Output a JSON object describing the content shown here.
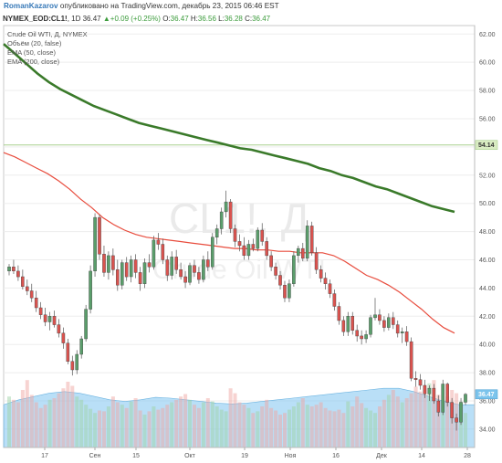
{
  "header": {
    "author": "RomanKazarov",
    "published": "опубликовано на TradingView.com, декабрь 23, 2015 06:46 EST"
  },
  "symbol_bar": {
    "symbol": "NYMEX_EOD:CL1!",
    "interval": "1D",
    "last": "36.47",
    "change": "+0.09 (+0.25%)",
    "open_label": "O:",
    "open": "36.47",
    "high_label": "H:",
    "high": "36.56",
    "low_label": "L:",
    "low": "36.28",
    "close_label": "C:",
    "close": "36.47"
  },
  "legend": {
    "title": "Crude Oil WTI, Д, NYMEX",
    "volume": "Объём (20, false)",
    "ema50": "EMA (50, close)",
    "ema200": "EMA (200, close)"
  },
  "watermark": {
    "symbol": "CL1!, Д",
    "name": "Crude Oil WTI"
  },
  "colors": {
    "up": "#5a9e6b",
    "down": "#d9534f",
    "ema50": "#e84c3d",
    "ema200": "#3a7a2a",
    "volume_area": "#7fc4f0",
    "hline": "#a8d08d"
  },
  "tags": {
    "hline": "54.14",
    "last": "36.47"
  },
  "chart_data": {
    "type": "candlestick",
    "title": "Crude Oil WTI, Д, NYMEX",
    "ylim": [
      33,
      62.5
    ],
    "y_ticks": [
      "62.00",
      "60.00",
      "58.00",
      "56.00",
      "54.00",
      "52.00",
      "50.00",
      "48.00",
      "46.00",
      "44.00",
      "42.00",
      "40.00",
      "38.00",
      "36.00",
      "34.00"
    ],
    "x_ticks": [
      "17",
      "Сен",
      "15",
      "Окт",
      "19",
      "Ноя",
      "16",
      "Дек",
      "14",
      "28"
    ],
    "horizontal_line": 54.14,
    "candles": [
      [
        45.2,
        45.7,
        44.9,
        45.5
      ],
      [
        45.5,
        46.0,
        45.0,
        45.2
      ],
      [
        45.2,
        45.6,
        44.5,
        44.8
      ],
      [
        44.8,
        45.3,
        43.9,
        44.1
      ],
      [
        44.1,
        44.6,
        43.5,
        43.8
      ],
      [
        43.8,
        44.3,
        43.0,
        43.3
      ],
      [
        43.3,
        43.8,
        42.3,
        42.6
      ],
      [
        42.6,
        43.0,
        41.8,
        42.1
      ],
      [
        42.1,
        42.6,
        41.3,
        41.6
      ],
      [
        41.6,
        42.3,
        41.0,
        42.0
      ],
      [
        42.0,
        42.4,
        41.2,
        41.4
      ],
      [
        41.4,
        41.8,
        40.5,
        40.8
      ],
      [
        40.8,
        41.2,
        39.7,
        40.1
      ],
      [
        40.1,
        40.4,
        38.6,
        38.8
      ],
      [
        38.8,
        39.2,
        37.8,
        38.2
      ],
      [
        38.2,
        39.6,
        37.9,
        39.3
      ],
      [
        39.3,
        40.6,
        39.0,
        40.4
      ],
      [
        40.4,
        42.8,
        40.2,
        42.5
      ],
      [
        42.5,
        45.6,
        42.2,
        45.2
      ],
      [
        45.2,
        49.3,
        44.8,
        49.0
      ],
      [
        49.0,
        49.2,
        46.0,
        46.4
      ],
      [
        46.4,
        47.0,
        44.8,
        45.1
      ],
      [
        45.1,
        46.6,
        44.6,
        46.3
      ],
      [
        46.3,
        46.8,
        44.9,
        45.3
      ],
      [
        45.3,
        46.0,
        43.8,
        44.2
      ],
      [
        44.2,
        46.0,
        43.9,
        45.8
      ],
      [
        45.8,
        46.2,
        44.5,
        44.8
      ],
      [
        44.8,
        46.3,
        44.4,
        46.0
      ],
      [
        46.0,
        46.4,
        44.7,
        45.1
      ],
      [
        45.1,
        45.5,
        43.8,
        44.3
      ],
      [
        44.3,
        46.1,
        44.0,
        45.8
      ],
      [
        45.8,
        46.4,
        45.1,
        45.5
      ],
      [
        45.5,
        47.7,
        45.3,
        47.4
      ],
      [
        47.4,
        47.9,
        46.7,
        47.1
      ],
      [
        47.1,
        47.5,
        45.7,
        46.0
      ],
      [
        46.0,
        46.3,
        44.5,
        44.9
      ],
      [
        44.9,
        46.6,
        44.6,
        46.2
      ],
      [
        46.2,
        46.7,
        45.0,
        45.3
      ],
      [
        45.3,
        45.8,
        44.6,
        44.8
      ],
      [
        44.8,
        45.2,
        44.0,
        44.4
      ],
      [
        44.4,
        45.8,
        44.2,
        45.6
      ],
      [
        45.6,
        46.0,
        44.8,
        45.1
      ],
      [
        45.1,
        45.5,
        44.3,
        44.6
      ],
      [
        44.6,
        46.3,
        44.4,
        46.0
      ],
      [
        46.0,
        46.6,
        45.2,
        45.5
      ],
      [
        45.5,
        47.9,
        45.3,
        47.6
      ],
      [
        47.6,
        48.5,
        47.1,
        48.2
      ],
      [
        48.2,
        49.7,
        47.8,
        49.4
      ],
      [
        49.4,
        50.9,
        49.0,
        50.1
      ],
      [
        50.1,
        50.3,
        47.9,
        48.2
      ],
      [
        48.2,
        48.5,
        46.9,
        47.3
      ],
      [
        47.3,
        47.8,
        46.6,
        47.0
      ],
      [
        47.0,
        47.6,
        46.0,
        46.3
      ],
      [
        46.3,
        47.4,
        46.0,
        47.1
      ],
      [
        47.1,
        47.5,
        46.6,
        46.8
      ],
      [
        46.8,
        48.3,
        46.6,
        48.1
      ],
      [
        48.1,
        48.6,
        47.0,
        47.3
      ],
      [
        47.3,
        47.6,
        46.0,
        46.3
      ],
      [
        46.3,
        46.6,
        45.2,
        45.5
      ],
      [
        45.5,
        45.8,
        44.6,
        44.9
      ],
      [
        44.9,
        45.2,
        43.9,
        44.2
      ],
      [
        44.2,
        44.5,
        43.0,
        43.3
      ],
      [
        43.3,
        44.6,
        43.0,
        44.3
      ],
      [
        44.3,
        46.6,
        44.1,
        46.3
      ],
      [
        46.3,
        47.0,
        45.8,
        46.8
      ],
      [
        46.8,
        47.2,
        45.9,
        46.1
      ],
      [
        46.1,
        48.8,
        45.9,
        48.4
      ],
      [
        48.4,
        48.7,
        46.3,
        46.5
      ],
      [
        46.5,
        46.9,
        45.0,
        45.3
      ],
      [
        45.3,
        45.6,
        44.4,
        44.7
      ],
      [
        44.7,
        45.1,
        43.9,
        44.3
      ],
      [
        44.3,
        44.6,
        43.3,
        43.6
      ],
      [
        43.6,
        43.9,
        42.4,
        42.7
      ],
      [
        42.7,
        43.0,
        41.4,
        41.7
      ],
      [
        41.7,
        42.0,
        40.6,
        40.9
      ],
      [
        40.9,
        42.3,
        40.6,
        42.0
      ],
      [
        42.0,
        42.3,
        40.7,
        41.0
      ],
      [
        41.0,
        41.4,
        40.2,
        40.6
      ],
      [
        40.6,
        41.0,
        40.0,
        40.4
      ],
      [
        40.4,
        41.0,
        40.1,
        40.7
      ],
      [
        40.7,
        42.1,
        40.5,
        41.9
      ],
      [
        41.9,
        43.3,
        41.7,
        42.1
      ],
      [
        42.1,
        42.5,
        41.4,
        41.7
      ],
      [
        41.7,
        42.0,
        40.9,
        41.2
      ],
      [
        41.2,
        42.2,
        41.0,
        41.9
      ],
      [
        41.9,
        42.3,
        41.1,
        41.4
      ],
      [
        41.4,
        41.7,
        40.5,
        40.8
      ],
      [
        40.8,
        41.2,
        40.1,
        40.9
      ],
      [
        40.9,
        41.3,
        39.9,
        40.2
      ],
      [
        40.2,
        40.5,
        37.4,
        37.6
      ],
      [
        37.6,
        38.1,
        37.0,
        37.5
      ],
      [
        37.5,
        37.9,
        36.8,
        37.1
      ],
      [
        37.1,
        37.5,
        36.2,
        36.5
      ],
      [
        36.5,
        37.1,
        36.0,
        36.9
      ],
      [
        36.9,
        37.2,
        35.8,
        36.0
      ],
      [
        36.0,
        36.4,
        34.9,
        35.2
      ],
      [
        35.2,
        37.5,
        35.0,
        37.2
      ],
      [
        37.2,
        37.3,
        35.6,
        35.9
      ],
      [
        35.9,
        36.2,
        34.4,
        34.8
      ],
      [
        34.8,
        35.1,
        33.9,
        34.5
      ],
      [
        34.5,
        36.2,
        34.3,
        35.9
      ],
      [
        35.9,
        36.56,
        35.7,
        36.47
      ]
    ],
    "ema50": [
      53.6,
      53.3,
      52.9,
      52.5,
      52.1,
      51.6,
      51.0,
      50.3,
      49.7,
      49.0,
      48.5,
      48.1,
      47.8,
      47.6,
      47.5,
      47.4,
      47.3,
      47.2,
      47.1,
      47.0,
      46.9,
      46.8,
      46.8,
      46.7,
      46.7,
      46.6,
      46.6,
      46.5,
      46.5,
      46.5,
      46.3,
      45.9,
      45.4,
      44.9,
      44.6,
      44.2,
      43.7,
      43.1,
      42.5,
      41.8,
      41.2,
      40.8
    ],
    "ema200": [
      61.3,
      60.6,
      59.9,
      59.2,
      58.6,
      58.1,
      57.7,
      57.3,
      56.9,
      56.6,
      56.3,
      56.0,
      55.7,
      55.5,
      55.3,
      55.1,
      54.9,
      54.7,
      54.5,
      54.3,
      54.1,
      53.9,
      53.8,
      53.6,
      53.4,
      53.2,
      53.0,
      52.8,
      52.5,
      52.3,
      52.0,
      51.8,
      51.5,
      51.2,
      51.0,
      50.7,
      50.4,
      50.1,
      49.8,
      49.6,
      49.4
    ],
    "volume_area": [
      0.52,
      0.58,
      0.62,
      0.66,
      0.68,
      0.66,
      0.62,
      0.58,
      0.56,
      0.58,
      0.61,
      0.6,
      0.58,
      0.56,
      0.54,
      0.53,
      0.54,
      0.56,
      0.58,
      0.6,
      0.62,
      0.64,
      0.66,
      0.68,
      0.7,
      0.72,
      0.72,
      0.68,
      0.62,
      0.56,
      0.52,
      0.52
    ],
    "volume_bars": [
      0.62,
      0.58,
      0.55,
      0.7,
      0.82,
      0.64,
      0.55,
      0.48,
      0.52,
      0.58,
      0.6,
      0.66,
      0.72,
      0.8,
      0.75,
      0.62,
      0.58,
      0.52,
      0.47,
      0.42,
      0.45,
      0.44,
      0.5,
      0.62,
      0.55,
      0.52,
      0.48,
      0.56,
      0.6,
      0.45,
      0.4,
      0.44,
      0.5,
      0.46,
      0.48,
      0.52,
      0.55,
      0.58,
      0.62,
      0.65,
      0.58,
      0.52,
      0.48,
      0.55,
      0.6,
      0.56,
      0.5,
      0.46,
      0.44,
      0.72,
      0.66,
      0.55,
      0.52,
      0.48,
      0.42,
      0.44,
      0.5,
      0.58,
      0.48,
      0.45,
      0.4,
      0.42,
      0.46,
      0.5,
      0.55,
      0.6,
      0.52,
      0.5,
      0.52,
      0.55,
      0.48,
      0.45,
      0.44,
      0.46,
      0.42,
      0.56,
      0.5,
      0.62,
      0.54,
      0.48,
      0.45,
      0.42,
      0.5,
      0.58,
      0.64,
      0.7,
      0.62,
      0.55,
      0.6,
      0.66,
      0.74,
      0.68,
      0.72,
      0.78,
      0.82,
      0.64,
      0.58,
      0.62,
      0.7,
      0.66,
      0.56,
      0.42
    ]
  }
}
